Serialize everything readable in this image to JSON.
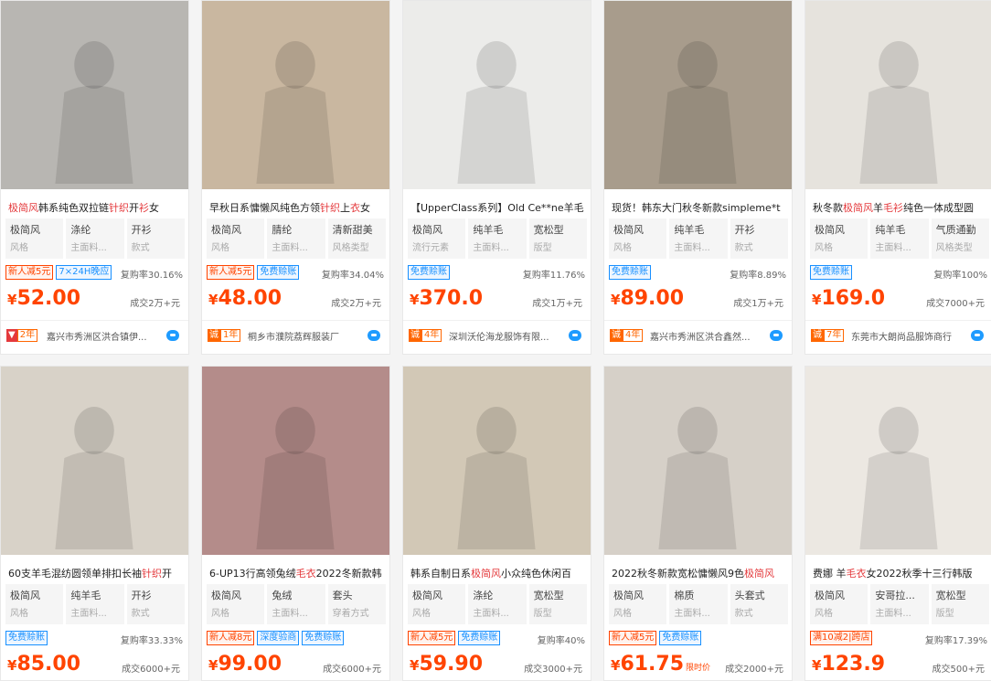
{
  "colors": {
    "accent": "#ff4400",
    "blue": "#1890ff",
    "shop_orange": "#ff6600",
    "bg": "#f4f4f4"
  },
  "products": [
    {
      "img": "#b8b6b2",
      "title": [
        {
          "t": "极简风",
          "hl": true
        },
        {
          "t": "韩系纯色双拉链"
        },
        {
          "t": "针织",
          "hl": true
        },
        {
          "t": "开"
        },
        {
          "t": "衫",
          "hl": true
        },
        {
          "t": "女"
        }
      ],
      "attrs": [
        {
          "v": "极简风",
          "k": "风格"
        },
        {
          "v": "涤纶",
          "k": "主面料..."
        },
        {
          "v": "开衫",
          "k": "款式"
        }
      ],
      "tags": [
        {
          "text": "新人减5元",
          "type": "red"
        },
        {
          "text": "7×24H晚应",
          "type": "blue"
        }
      ],
      "repurchase": "复购率30.16%",
      "price": "52.00",
      "flash": "",
      "sales": "成交2万+元",
      "shop_badge": "2年",
      "shop_badge_type": "hot",
      "shop": "嘉兴市秀洲区洪合镇伊..."
    },
    {
      "img": "#c9b7a0",
      "title": [
        {
          "t": "早秋日系慵懒风纯色方领"
        },
        {
          "t": "针织",
          "hl": true
        },
        {
          "t": "上"
        },
        {
          "t": "衣",
          "hl": true
        },
        {
          "t": "女"
        }
      ],
      "attrs": [
        {
          "v": "极简风",
          "k": "风格"
        },
        {
          "v": "腈纶",
          "k": "主面料..."
        },
        {
          "v": "清新甜美",
          "k": "风格类型"
        }
      ],
      "tags": [
        {
          "text": "新人减5元",
          "type": "red"
        },
        {
          "text": "免费赊账",
          "type": "blue"
        }
      ],
      "repurchase": "复购率34.04%",
      "price": "48.00",
      "flash": "",
      "sales": "成交2万+元",
      "shop_badge": "1年",
      "shop_badge_type": "",
      "shop": "桐乡市濮院荔辉服装厂"
    },
    {
      "img": "#ececea",
      "title": [
        {
          "t": "【UpperClass系列】Old Ce**ne羊毛"
        }
      ],
      "attrs": [
        {
          "v": "极简风",
          "k": "流行元素"
        },
        {
          "v": "纯羊毛",
          "k": "主面料..."
        },
        {
          "v": "宽松型",
          "k": "版型"
        }
      ],
      "tags": [
        {
          "text": "免费赊账",
          "type": "blue"
        }
      ],
      "repurchase": "复购率11.76%",
      "price": "370.0",
      "flash": "",
      "sales": "成交1万+元",
      "shop_badge": "4年",
      "shop_badge_type": "",
      "shop": "深圳沃伦海龙服饰有限..."
    },
    {
      "img": "#a89c8c",
      "title": [
        {
          "t": "现货！韩东大门秋冬新款simpleme*t"
        }
      ],
      "attrs": [
        {
          "v": "极简风",
          "k": "风格"
        },
        {
          "v": "纯羊毛",
          "k": "主面料..."
        },
        {
          "v": "开衫",
          "k": "款式"
        }
      ],
      "tags": [
        {
          "text": "免费赊账",
          "type": "blue"
        }
      ],
      "repurchase": "复购率8.89%",
      "price": "89.00",
      "flash": "",
      "sales": "成交1万+元",
      "shop_badge": "4年",
      "shop_badge_type": "",
      "shop": "嘉兴市秀洲区洪合鑫然..."
    },
    {
      "img": "#e6e3dd",
      "title": [
        {
          "t": "秋冬款"
        },
        {
          "t": "极简风",
          "hl": true
        },
        {
          "t": "羊"
        },
        {
          "t": "毛衫",
          "hl": true
        },
        {
          "t": "纯色一体成型圆"
        }
      ],
      "attrs": [
        {
          "v": "极简风",
          "k": "风格"
        },
        {
          "v": "纯羊毛",
          "k": "主面料..."
        },
        {
          "v": "气质通勤",
          "k": "风格类型"
        }
      ],
      "tags": [
        {
          "text": "免费赊账",
          "type": "blue"
        }
      ],
      "repurchase": "复购率100%",
      "price": "169.0",
      "flash": "",
      "sales": "成交7000+元",
      "shop_badge": "7年",
      "shop_badge_type": "",
      "shop": "东莞市大朗尚品服饰商行"
    },
    {
      "img": "#d8d2c8",
      "title": [
        {
          "t": "60支羊毛混纺圆领单排扣长袖"
        },
        {
          "t": "针织",
          "hl": true
        },
        {
          "t": "开"
        }
      ],
      "attrs": [
        {
          "v": "极简风",
          "k": "风格"
        },
        {
          "v": "纯羊毛",
          "k": "主面料..."
        },
        {
          "v": "开衫",
          "k": "款式"
        }
      ],
      "tags": [
        {
          "text": "免费赊账",
          "type": "blue"
        }
      ],
      "repurchase": "复购率33.33%",
      "price": "85.00",
      "flash": "",
      "sales": "成交6000+元",
      "shop_badge": "",
      "shop_badge_type": "",
      "shop": ""
    },
    {
      "img": "#b48c8a",
      "title": [
        {
          "t": "6-UP13行高领兔绒"
        },
        {
          "t": "毛衣",
          "hl": true
        },
        {
          "t": "2022冬新款韩"
        }
      ],
      "attrs": [
        {
          "v": "极简风",
          "k": "风格"
        },
        {
          "v": "兔绒",
          "k": "主面料..."
        },
        {
          "v": "套头",
          "k": "穿着方式"
        }
      ],
      "tags": [
        {
          "text": "新人减8元",
          "type": "red"
        },
        {
          "text": "深度验商",
          "type": "blue"
        },
        {
          "text": "免费赊账",
          "type": "blue"
        }
      ],
      "repurchase": "",
      "price": "99.00",
      "flash": "",
      "sales": "成交6000+元",
      "shop_badge": "",
      "shop_badge_type": "",
      "shop": ""
    },
    {
      "img": "#d2c8b6",
      "title": [
        {
          "t": "韩系自制日系"
        },
        {
          "t": "极简风",
          "hl": true
        },
        {
          "t": "小众纯色休闲百"
        }
      ],
      "attrs": [
        {
          "v": "极简风",
          "k": "风格"
        },
        {
          "v": "涤纶",
          "k": "主面料..."
        },
        {
          "v": "宽松型",
          "k": "版型"
        }
      ],
      "tags": [
        {
          "text": "新人减5元",
          "type": "red"
        },
        {
          "text": "免费赊账",
          "type": "blue"
        }
      ],
      "repurchase": "复购率40%",
      "price": "59.90",
      "flash": "",
      "sales": "成交3000+元",
      "shop_badge": "",
      "shop_badge_type": "",
      "shop": ""
    },
    {
      "img": "#d6d0c8",
      "title": [
        {
          "t": "2022秋冬新款宽松慵懒风9色"
        },
        {
          "t": "极简风",
          "hl": true
        }
      ],
      "attrs": [
        {
          "v": "极简风",
          "k": "风格"
        },
        {
          "v": "棉质",
          "k": "主面料..."
        },
        {
          "v": "头套式",
          "k": "款式"
        }
      ],
      "tags": [
        {
          "text": "新人减5元",
          "type": "red"
        },
        {
          "text": "免费赊账",
          "type": "blue"
        }
      ],
      "repurchase": "",
      "price": "61.75",
      "flash": "限时价",
      "sales": "成交2000+元",
      "shop_badge": "",
      "shop_badge_type": "",
      "shop": ""
    },
    {
      "img": "#ece8e2",
      "title": [
        {
          "t": "费娜 羊"
        },
        {
          "t": "毛衣",
          "hl": true
        },
        {
          "t": "女2022秋季十三行韩版"
        }
      ],
      "attrs": [
        {
          "v": "极简风",
          "k": "风格"
        },
        {
          "v": "安哥拉...",
          "k": "主面料..."
        },
        {
          "v": "宽松型",
          "k": "版型"
        }
      ],
      "tags": [
        {
          "text": "满10减2|跨店",
          "type": "red"
        }
      ],
      "repurchase": "复购率17.39%",
      "price": "123.9",
      "flash": "",
      "sales": "成交500+元",
      "shop_badge": "",
      "shop_badge_type": "",
      "shop": ""
    }
  ]
}
